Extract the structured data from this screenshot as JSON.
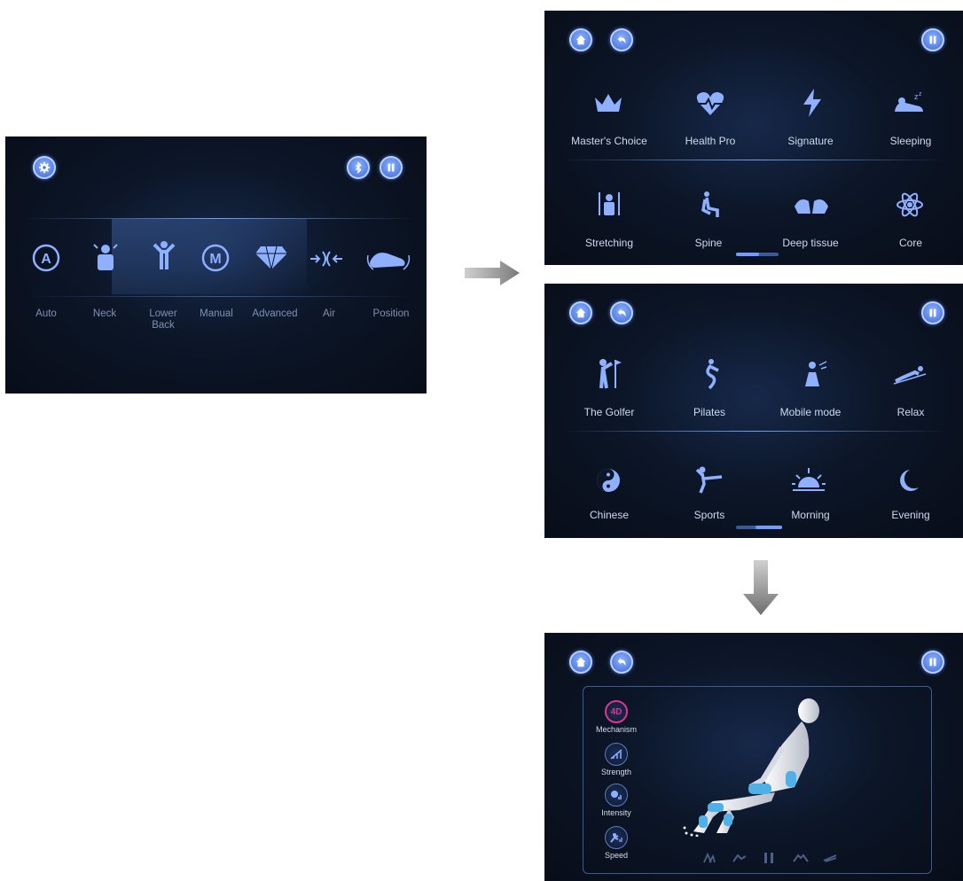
{
  "main_panel": {
    "modes": [
      {
        "label": "Auto",
        "icon": "auto-a-icon"
      },
      {
        "label": "Neck",
        "icon": "neck-icon"
      },
      {
        "label": "Lower\nBack",
        "icon": "lower-back-icon"
      },
      {
        "label": "Manual",
        "icon": "manual-m-icon"
      },
      {
        "label": "Advanced",
        "icon": "diamond-icon"
      },
      {
        "label": "Air",
        "icon": "air-icon"
      },
      {
        "label": "Position",
        "icon": "position-icon"
      }
    ]
  },
  "programs_panel_1": {
    "row1": [
      {
        "label": "Master's Choice",
        "icon": "crown-icon"
      },
      {
        "label": "Health Pro",
        "icon": "heart-pulse-icon"
      },
      {
        "label": "Signature",
        "icon": "lightning-icon"
      },
      {
        "label": "Sleeping",
        "icon": "sleeping-icon"
      }
    ],
    "row2": [
      {
        "label": "Stretching",
        "icon": "stretching-icon"
      },
      {
        "label": "Spine",
        "icon": "spine-icon"
      },
      {
        "label": "Deep tissue",
        "icon": "deep-tissue-icon"
      },
      {
        "label": "Core",
        "icon": "atom-icon"
      }
    ],
    "page_index": 1
  },
  "programs_panel_2": {
    "row1": [
      {
        "label": "The Golfer",
        "icon": "golfer-icon"
      },
      {
        "label": "Pilates",
        "icon": "pilates-icon"
      },
      {
        "label": "Mobile mode",
        "icon": "mobile-mode-icon"
      },
      {
        "label": "Relax",
        "icon": "relax-icon"
      }
    ],
    "row2": [
      {
        "label": "Chinese",
        "icon": "yin-yang-icon"
      },
      {
        "label": "Sports",
        "icon": "sports-icon"
      },
      {
        "label": "Morning",
        "icon": "sunrise-icon"
      },
      {
        "label": "Evening",
        "icon": "moon-icon"
      }
    ],
    "page_index": 2
  },
  "detail_panel": {
    "controls": [
      {
        "label": "Mechanism",
        "badge": "4D"
      },
      {
        "label": "Strength",
        "badge": ""
      },
      {
        "label": "Intensity",
        "badge": ""
      },
      {
        "label": "Speed",
        "badge": ""
      }
    ]
  },
  "colors": {
    "accent": "#6f9dff",
    "icon": "#8fb0ff",
    "badge": "#e0358c",
    "panel": "#0c1628"
  }
}
